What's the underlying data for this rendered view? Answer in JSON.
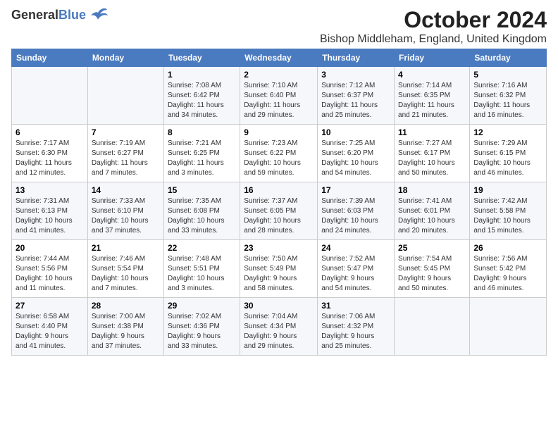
{
  "header": {
    "logo_general": "General",
    "logo_blue": "Blue",
    "month_title": "October 2024",
    "location": "Bishop Middleham, England, United Kingdom"
  },
  "days_of_week": [
    "Sunday",
    "Monday",
    "Tuesday",
    "Wednesday",
    "Thursday",
    "Friday",
    "Saturday"
  ],
  "weeks": [
    [
      {
        "day": "",
        "info": ""
      },
      {
        "day": "",
        "info": ""
      },
      {
        "day": "1",
        "info": "Sunrise: 7:08 AM\nSunset: 6:42 PM\nDaylight: 11 hours\nand 34 minutes."
      },
      {
        "day": "2",
        "info": "Sunrise: 7:10 AM\nSunset: 6:40 PM\nDaylight: 11 hours\nand 29 minutes."
      },
      {
        "day": "3",
        "info": "Sunrise: 7:12 AM\nSunset: 6:37 PM\nDaylight: 11 hours\nand 25 minutes."
      },
      {
        "day": "4",
        "info": "Sunrise: 7:14 AM\nSunset: 6:35 PM\nDaylight: 11 hours\nand 21 minutes."
      },
      {
        "day": "5",
        "info": "Sunrise: 7:16 AM\nSunset: 6:32 PM\nDaylight: 11 hours\nand 16 minutes."
      }
    ],
    [
      {
        "day": "6",
        "info": "Sunrise: 7:17 AM\nSunset: 6:30 PM\nDaylight: 11 hours\nand 12 minutes."
      },
      {
        "day": "7",
        "info": "Sunrise: 7:19 AM\nSunset: 6:27 PM\nDaylight: 11 hours\nand 7 minutes."
      },
      {
        "day": "8",
        "info": "Sunrise: 7:21 AM\nSunset: 6:25 PM\nDaylight: 11 hours\nand 3 minutes."
      },
      {
        "day": "9",
        "info": "Sunrise: 7:23 AM\nSunset: 6:22 PM\nDaylight: 10 hours\nand 59 minutes."
      },
      {
        "day": "10",
        "info": "Sunrise: 7:25 AM\nSunset: 6:20 PM\nDaylight: 10 hours\nand 54 minutes."
      },
      {
        "day": "11",
        "info": "Sunrise: 7:27 AM\nSunset: 6:17 PM\nDaylight: 10 hours\nand 50 minutes."
      },
      {
        "day": "12",
        "info": "Sunrise: 7:29 AM\nSunset: 6:15 PM\nDaylight: 10 hours\nand 46 minutes."
      }
    ],
    [
      {
        "day": "13",
        "info": "Sunrise: 7:31 AM\nSunset: 6:13 PM\nDaylight: 10 hours\nand 41 minutes."
      },
      {
        "day": "14",
        "info": "Sunrise: 7:33 AM\nSunset: 6:10 PM\nDaylight: 10 hours\nand 37 minutes."
      },
      {
        "day": "15",
        "info": "Sunrise: 7:35 AM\nSunset: 6:08 PM\nDaylight: 10 hours\nand 33 minutes."
      },
      {
        "day": "16",
        "info": "Sunrise: 7:37 AM\nSunset: 6:05 PM\nDaylight: 10 hours\nand 28 minutes."
      },
      {
        "day": "17",
        "info": "Sunrise: 7:39 AM\nSunset: 6:03 PM\nDaylight: 10 hours\nand 24 minutes."
      },
      {
        "day": "18",
        "info": "Sunrise: 7:41 AM\nSunset: 6:01 PM\nDaylight: 10 hours\nand 20 minutes."
      },
      {
        "day": "19",
        "info": "Sunrise: 7:42 AM\nSunset: 5:58 PM\nDaylight: 10 hours\nand 15 minutes."
      }
    ],
    [
      {
        "day": "20",
        "info": "Sunrise: 7:44 AM\nSunset: 5:56 PM\nDaylight: 10 hours\nand 11 minutes."
      },
      {
        "day": "21",
        "info": "Sunrise: 7:46 AM\nSunset: 5:54 PM\nDaylight: 10 hours\nand 7 minutes."
      },
      {
        "day": "22",
        "info": "Sunrise: 7:48 AM\nSunset: 5:51 PM\nDaylight: 10 hours\nand 3 minutes."
      },
      {
        "day": "23",
        "info": "Sunrise: 7:50 AM\nSunset: 5:49 PM\nDaylight: 9 hours\nand 58 minutes."
      },
      {
        "day": "24",
        "info": "Sunrise: 7:52 AM\nSunset: 5:47 PM\nDaylight: 9 hours\nand 54 minutes."
      },
      {
        "day": "25",
        "info": "Sunrise: 7:54 AM\nSunset: 5:45 PM\nDaylight: 9 hours\nand 50 minutes."
      },
      {
        "day": "26",
        "info": "Sunrise: 7:56 AM\nSunset: 5:42 PM\nDaylight: 9 hours\nand 46 minutes."
      }
    ],
    [
      {
        "day": "27",
        "info": "Sunrise: 6:58 AM\nSunset: 4:40 PM\nDaylight: 9 hours\nand 41 minutes."
      },
      {
        "day": "28",
        "info": "Sunrise: 7:00 AM\nSunset: 4:38 PM\nDaylight: 9 hours\nand 37 minutes."
      },
      {
        "day": "29",
        "info": "Sunrise: 7:02 AM\nSunset: 4:36 PM\nDaylight: 9 hours\nand 33 minutes."
      },
      {
        "day": "30",
        "info": "Sunrise: 7:04 AM\nSunset: 4:34 PM\nDaylight: 9 hours\nand 29 minutes."
      },
      {
        "day": "31",
        "info": "Sunrise: 7:06 AM\nSunset: 4:32 PM\nDaylight: 9 hours\nand 25 minutes."
      },
      {
        "day": "",
        "info": ""
      },
      {
        "day": "",
        "info": ""
      }
    ]
  ]
}
